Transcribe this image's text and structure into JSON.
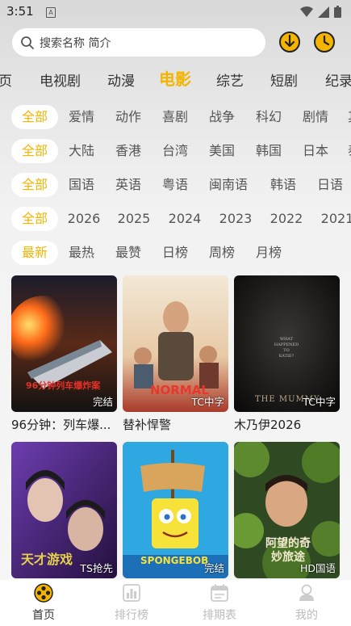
{
  "status": {
    "time": "3:51",
    "sim": "A"
  },
  "search": {
    "placeholder": "搜索名称 简介"
  },
  "header_icons": [
    "download-icon",
    "history-icon"
  ],
  "categories": [
    "页",
    "电视剧",
    "动漫",
    "电影",
    "综艺",
    "短剧",
    "纪录"
  ],
  "active_category": "电影",
  "filters": {
    "genre": [
      "全部",
      "爱情",
      "动作",
      "喜剧",
      "战争",
      "科幻",
      "剧情",
      "其"
    ],
    "region": [
      "全部",
      "大陆",
      "香港",
      "台湾",
      "美国",
      "韩国",
      "日本",
      "泰"
    ],
    "language": [
      "全部",
      "国语",
      "英语",
      "粤语",
      "闽南语",
      "韩语",
      "日语"
    ],
    "year": [
      "全部",
      "2026",
      "2025",
      "2024",
      "2023",
      "2022",
      "2021"
    ],
    "sort": [
      "最新",
      "最热",
      "最赞",
      "日榜",
      "周榜",
      "月榜"
    ]
  },
  "movies": [
    {
      "title": "96分钟：列车爆...",
      "badge": "完结",
      "poster_text": "96分钟列车爆炸案"
    },
    {
      "title": "替补悍警",
      "badge": "TC中字",
      "poster_text": "NORMAL"
    },
    {
      "title": "木乃伊2026",
      "badge": "TC中字",
      "poster_text": "THE MUMMY"
    },
    {
      "title": "",
      "badge": "TS抢先",
      "poster_text": "天才游戏"
    },
    {
      "title": "",
      "badge": "完结",
      "poster_text": "SPONGEBOB"
    },
    {
      "title": "",
      "badge": "HD国语",
      "poster_text": "阿望的奇妙旅途"
    }
  ],
  "tabs": [
    {
      "label": "首页",
      "icon": "home-film-icon"
    },
    {
      "label": "排行榜",
      "icon": "ranking-icon"
    },
    {
      "label": "排期表",
      "icon": "calendar-icon"
    },
    {
      "label": "我的",
      "icon": "profile-icon"
    }
  ],
  "colors": {
    "accent": "#f4b400",
    "inactive_tab": "#bbbbbb"
  }
}
